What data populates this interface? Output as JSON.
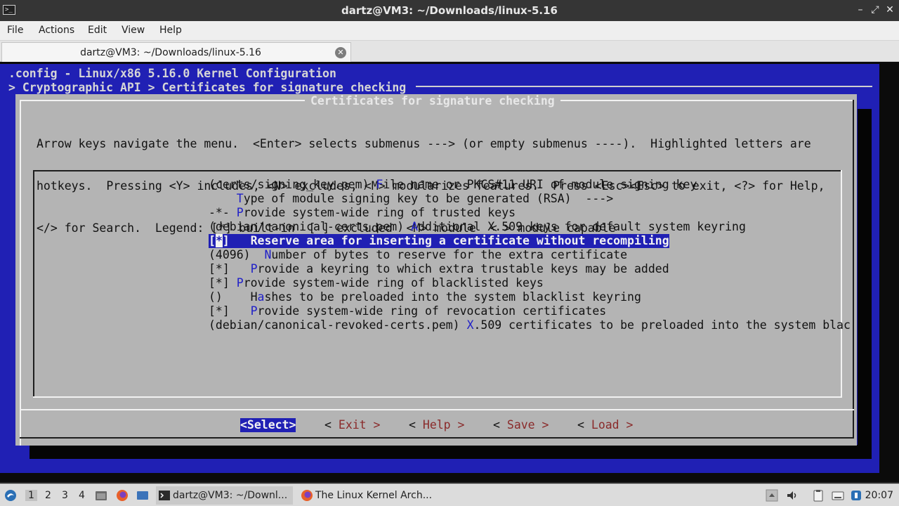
{
  "window": {
    "title": "dartz@VM3: ~/Downloads/linux-5.16",
    "minimize_glyph": "–",
    "maximize_glyph": "⤢",
    "close_glyph": "✕"
  },
  "menubar": {
    "file": "File",
    "actions": "Actions",
    "edit": "Edit",
    "view": "View",
    "help": "Help"
  },
  "tab": {
    "label": "dartz@VM3: ~/Downloads/linux-5.16",
    "close_glyph": "✕"
  },
  "terminal": {
    "config_title": ".config - Linux/x86 5.16.0 Kernel Configuration",
    "breadcrumb": "> Cryptographic API > Certificates for signature checking",
    "dialog_title": "Certificates for signature checking",
    "help_lines": [
      "Arrow keys navigate the menu.  <Enter> selects submenus ---> (or empty submenus ----).  Highlighted letters are",
      "hotkeys.  Pressing <Y> includes, <N> excludes, <M> modularizes features.  Press <Esc><Esc> to exit, <?> for Help,",
      "</> for Search.  Legend: [*] built-in  [ ] excluded  <M> module  < > module capable"
    ],
    "items": [
      {
        "pre": "(certs/signing_key.pem) ",
        "hotkey": "F",
        "rest": "ile name or PKCS#11 URI of module signing key"
      },
      {
        "pre": "    ",
        "hotkey": "T",
        "rest": "ype of module signing key to be generated (RSA)  --->"
      },
      {
        "pre": "-*- ",
        "hotkey": "P",
        "rest": "rovide system-wide ring of trusted keys"
      },
      {
        "pre": "(debian/canonical-certs.pem) ",
        "hotkey": "A",
        "rest": "dditional X.509 keys for default system keyring"
      },
      {
        "open": "[",
        "cursor": "*",
        "close": "]",
        "rest": "   Reserve area for inserting a certificate without recompiling"
      },
      {
        "pre": "(4096)  ",
        "hotkey": "N",
        "rest": "umber of bytes to reserve for the extra certificate"
      },
      {
        "pre": "[*]   ",
        "hotkey": "P",
        "rest": "rovide a keyring to which extra trustable keys may be added"
      },
      {
        "pre": "[*] ",
        "hotkey": "P",
        "rest": "rovide system-wide ring of blacklisted keys"
      },
      {
        "pre": "()    H",
        "hotkey": "a",
        "rest": "shes to be preloaded into the system blacklist keyring"
      },
      {
        "pre": "[*]   ",
        "hotkey": "P",
        "rest": "rovide system-wide ring of revocation certificates"
      },
      {
        "pre": "(debian/canonical-revoked-certs.pem) ",
        "hotkey": "X",
        "rest": ".509 certificates to be preloaded into the system blac"
      }
    ],
    "buttons": {
      "select": "<Select>",
      "exit": {
        "open": "< ",
        "hot": "E",
        "rest": "xit >"
      },
      "help": {
        "open": "< ",
        "hot": "H",
        "rest": "elp >"
      },
      "save": {
        "open": "< ",
        "hot": "S",
        "rest": "ave >"
      },
      "load": {
        "open": "< ",
        "hot": "L",
        "rest": "oad >"
      }
    }
  },
  "taskbar": {
    "workspaces": [
      "1",
      "2",
      "3",
      "4"
    ],
    "tasks": [
      "dartz@VM3: ~/Downl...",
      "The Linux Kernel Arch..."
    ],
    "clock": "20:07"
  },
  "colors": {
    "terminal_blue": "#2020b4",
    "dialog_grey": "#b4b4b4",
    "hotkey": "#2020c8"
  }
}
